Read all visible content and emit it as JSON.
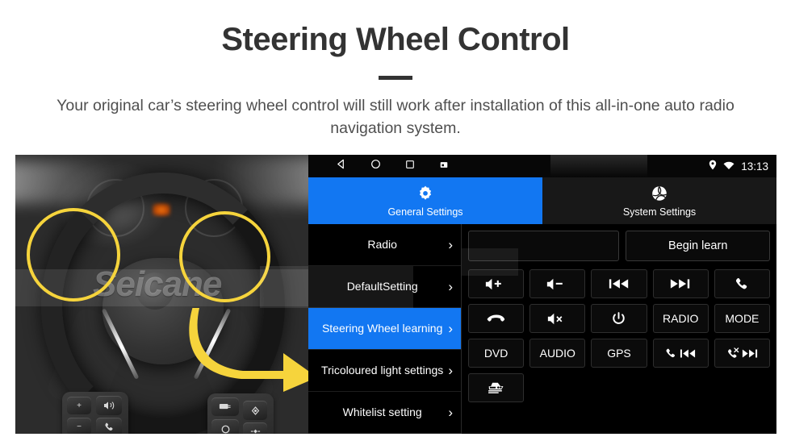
{
  "header": {
    "title": "Steering Wheel Control",
    "subtitle": "Your original car’s steering wheel control will still work after installation of this all-in-one auto radio navigation system."
  },
  "photo": {
    "watermark": "Seicane",
    "alt_description": "Grayscale close-up of a car steering wheel with two yellow circles highlighting the left and right control button clusters and a yellow arrow pointing to the head unit screen",
    "left_cluster_buttons": [
      "+",
      "voice-icon",
      "−",
      "phone-icon"
    ],
    "right_cluster_buttons": [
      "source-icon",
      "diamond-icon",
      "circle-icon",
      "down-icon"
    ],
    "highlight_color": "#f6d43c"
  },
  "head_unit": {
    "status_bar": {
      "nav_icons": [
        "back-icon",
        "home-icon",
        "recents-icon",
        "screenshot-icon"
      ],
      "location_icon": "location-pin-icon",
      "wifi_icon": "wifi-icon",
      "time": "13:13"
    },
    "tabs": [
      {
        "label": "General Settings",
        "icon": "gear-icon",
        "active": true
      },
      {
        "label": "System Settings",
        "icon": "system-swirl-icon",
        "active": false
      }
    ],
    "menu": [
      {
        "label": "Radio",
        "active": false
      },
      {
        "label": "DefaultSetting",
        "active": false
      },
      {
        "label": "Steering Wheel learning",
        "active": true
      },
      {
        "label": "Tricoloured light settings",
        "active": false
      },
      {
        "label": "Whitelist setting",
        "active": false
      }
    ],
    "panel": {
      "learn_field_value": "",
      "learn_field_placeholder": "",
      "begin_learn_label": "Begin learn",
      "buttons": [
        {
          "label": "",
          "icon": "volume-up-icon"
        },
        {
          "label": "",
          "icon": "volume-down-icon"
        },
        {
          "label": "",
          "icon": "previous-track-icon"
        },
        {
          "label": "",
          "icon": "next-track-icon"
        },
        {
          "label": "",
          "icon": "phone-answer-icon"
        },
        {
          "label": "",
          "icon": "phone-hangup-icon"
        },
        {
          "label": "",
          "icon": "mute-icon"
        },
        {
          "label": "",
          "icon": "power-icon"
        },
        {
          "label": "RADIO",
          "icon": ""
        },
        {
          "label": "MODE",
          "icon": ""
        },
        {
          "label": "DVD",
          "icon": ""
        },
        {
          "label": "AUDIO",
          "icon": ""
        },
        {
          "label": "GPS",
          "icon": ""
        },
        {
          "label": "",
          "icon": "phone-previous-icon"
        },
        {
          "label": "",
          "icon": "phone-decline-next-icon"
        },
        {
          "label": "",
          "icon": "car-view-icon"
        }
      ]
    },
    "accent_color": "#1277f2"
  }
}
